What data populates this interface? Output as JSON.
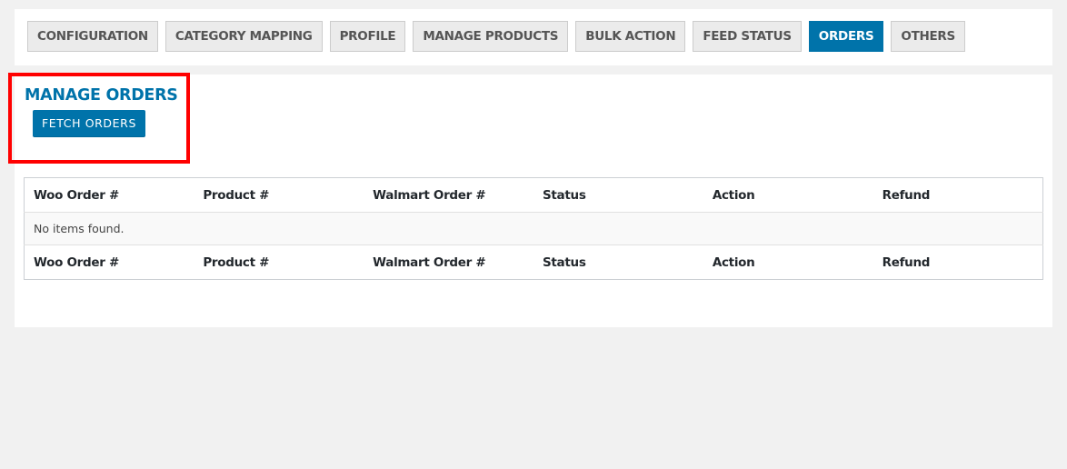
{
  "tabs": [
    {
      "label": "CONFIGURATION",
      "active": false
    },
    {
      "label": "CATEGORY MAPPING",
      "active": false
    },
    {
      "label": "PROFILE",
      "active": false
    },
    {
      "label": "MANAGE PRODUCTS",
      "active": false
    },
    {
      "label": "BULK ACTION",
      "active": false
    },
    {
      "label": "FEED STATUS",
      "active": false
    },
    {
      "label": "ORDERS",
      "active": true
    },
    {
      "label": "OTHERS",
      "active": false
    }
  ],
  "main": {
    "heading": "MANAGE ORDERS",
    "fetch_button": "FETCH ORDERS",
    "table": {
      "columns": [
        "Woo Order #",
        "Product #",
        "Walmart Order #",
        "Status",
        "Action",
        "Refund"
      ],
      "empty_message": "No items found."
    }
  },
  "colors": {
    "accent": "#0073aa",
    "highlight": "#ff0000"
  }
}
